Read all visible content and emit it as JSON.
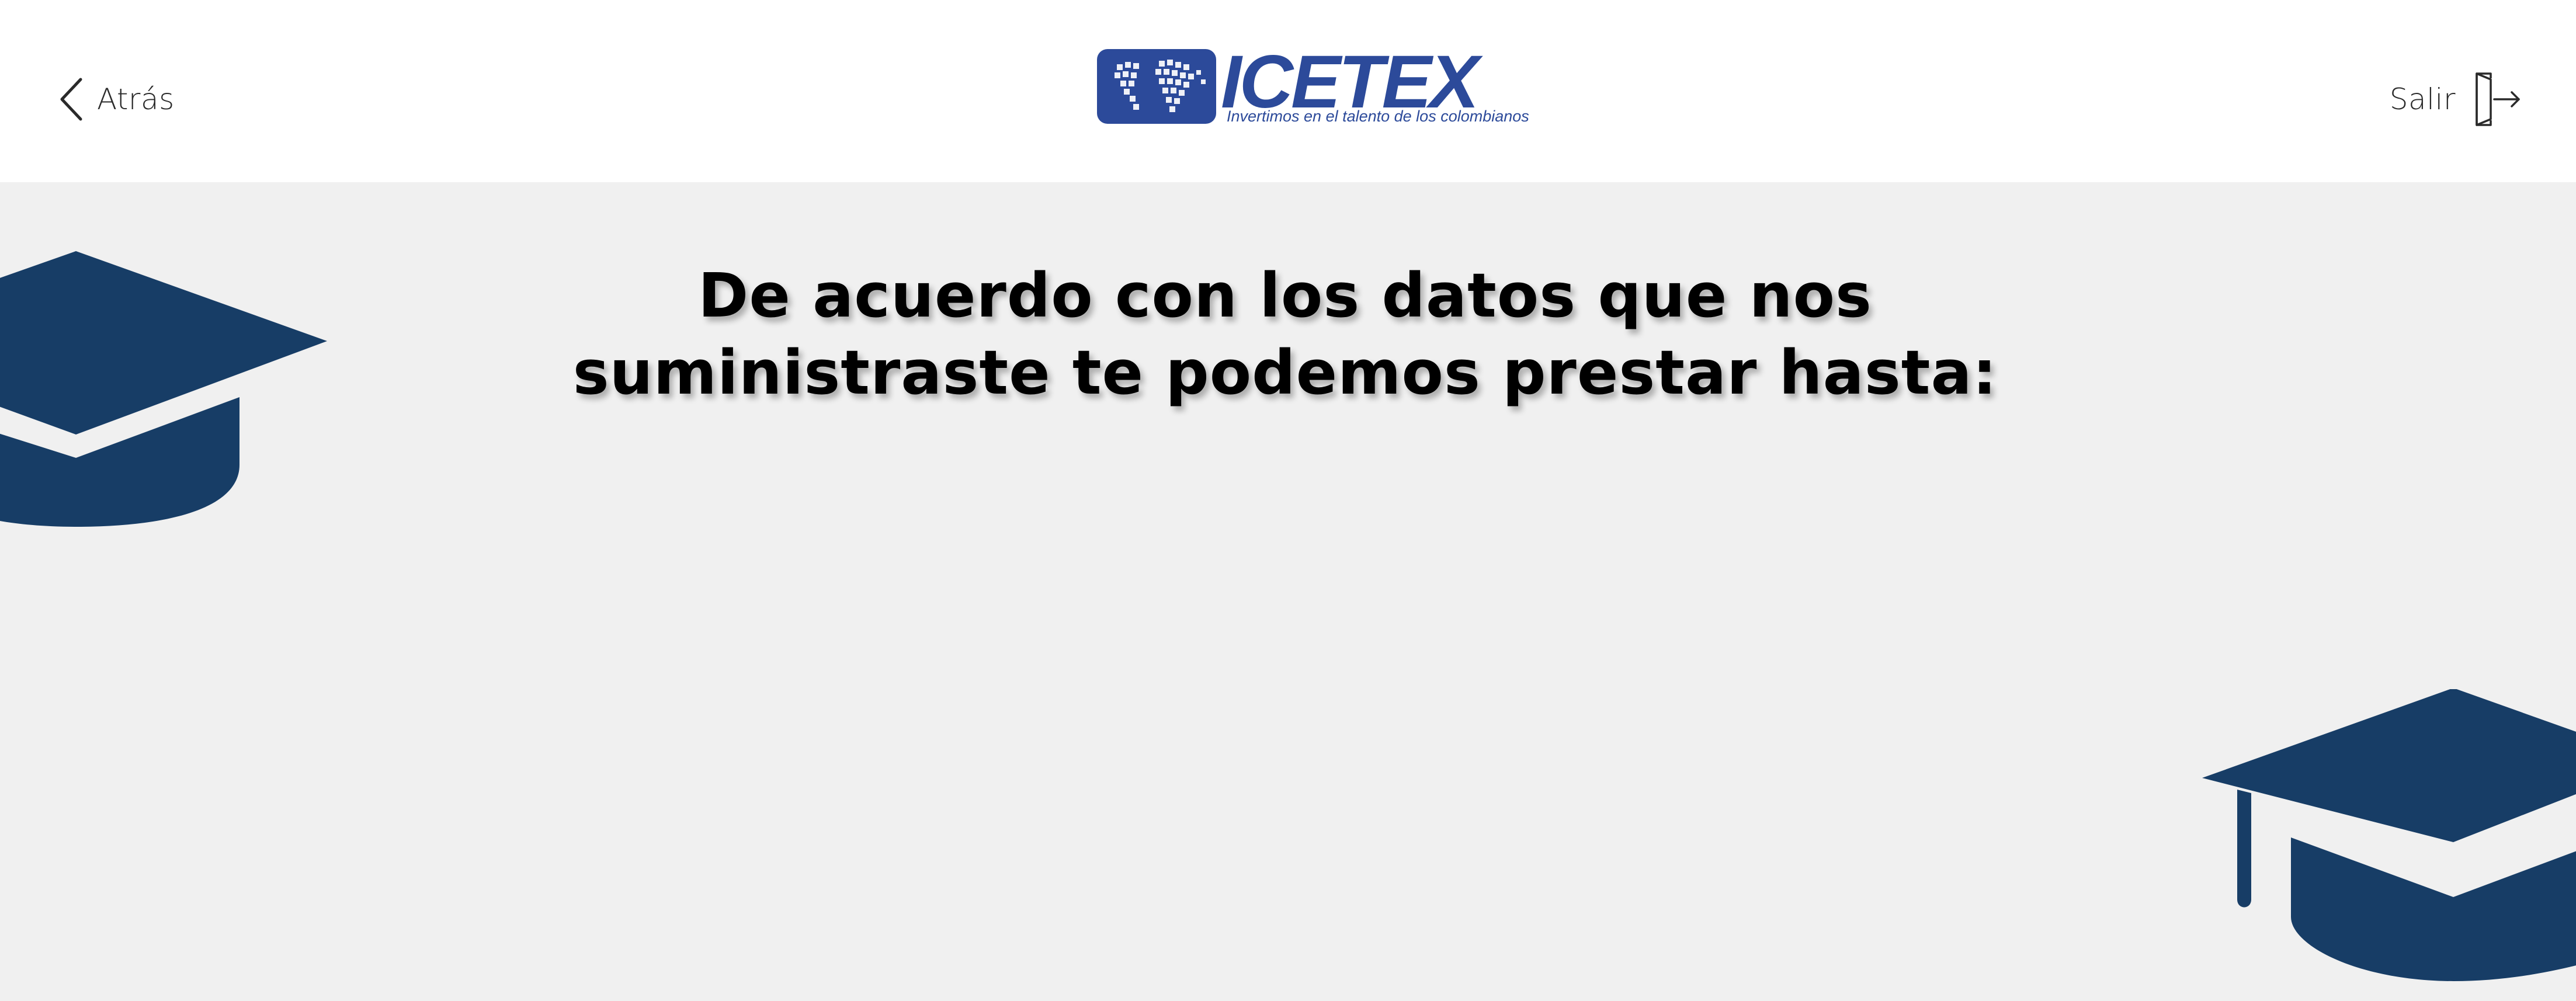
{
  "header": {
    "back_label": "Atrás",
    "exit_label": "Salir",
    "logo": {
      "brand": "ICETEX",
      "tagline": "Invertimos en el talento de los colombianos"
    }
  },
  "main": {
    "headline_line1": "De acuerdo con los datos que nos",
    "headline_line2": "suministraste te podemos prestar hasta:"
  },
  "icons": {
    "back": "chevron-left-icon",
    "exit": "exit-door-icon",
    "decoration": "graduation-cap-icon"
  },
  "colors": {
    "brand_blue": "#2c4a9a",
    "cap_navy": "#173d66",
    "background": "#f0f0f0",
    "header_bg": "#ffffff",
    "text": "#000000"
  }
}
